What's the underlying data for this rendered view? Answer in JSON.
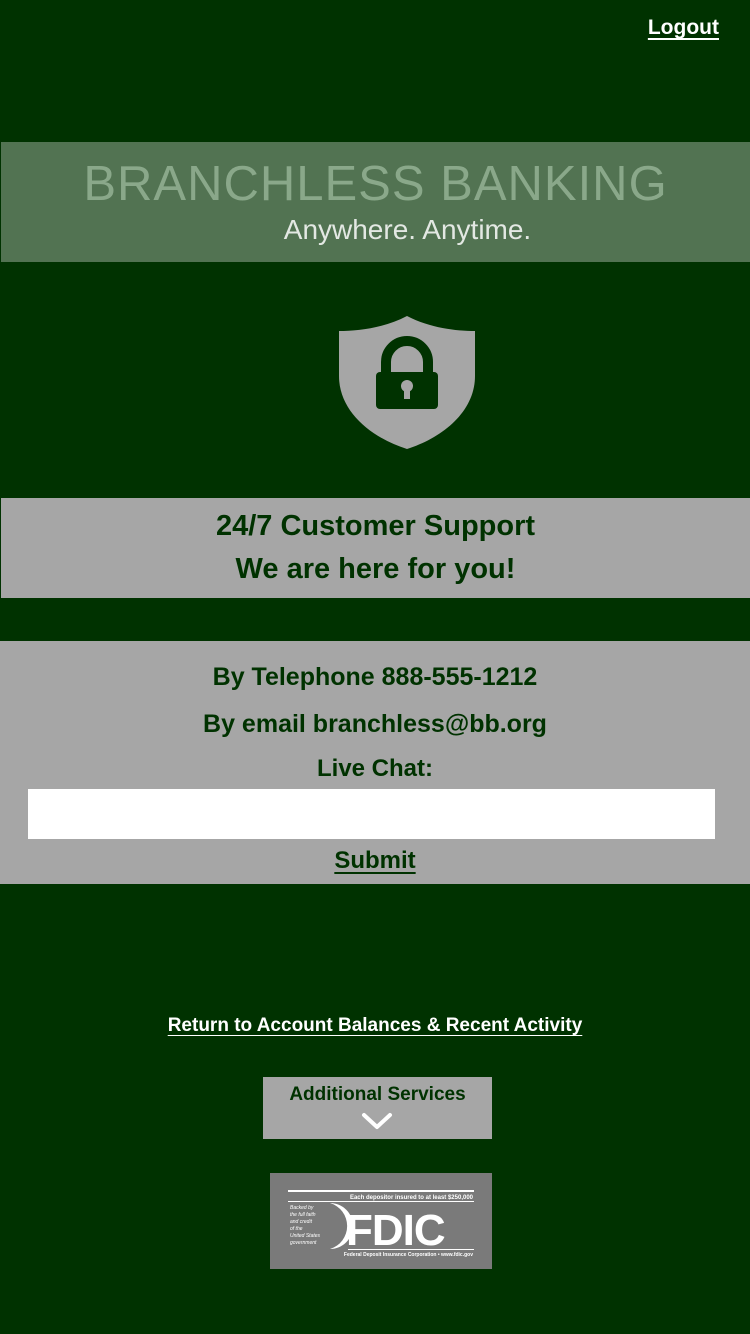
{
  "header": {
    "logout_label": "Logout"
  },
  "banner": {
    "title": "BRANCHLESS BANKING",
    "tagline": "Anywhere. Anytime."
  },
  "support": {
    "line1": "24/7 Customer Support",
    "line2": "We are here for you!"
  },
  "contact": {
    "phone": "By Telephone 888-555-1212",
    "email": "By email branchless@bb.org",
    "chat_label": "Live Chat:",
    "chat_value": "",
    "chat_placeholder": "",
    "submit_label": "Submit"
  },
  "nav": {
    "return_label": "Return to Account Balances & Recent Activity",
    "services_label": "Additional Services"
  },
  "fdic": {
    "top_text": "Each depositor insured to at least $250,000",
    "side_text": [
      "Backed by",
      "the full faith",
      "and credit",
      "of the",
      "United States",
      "government"
    ],
    "logo_text": "FDIC",
    "bottom_text": "Federal Deposit Insurance Corporation • www.fdic.gov"
  },
  "colors": {
    "background": "#003200",
    "banner": "#527352",
    "panel": "#a6a6a6",
    "text_dark": "#003200"
  },
  "icons": {
    "shield": "shield-lock-icon",
    "chevron": "chevron-down-icon"
  }
}
